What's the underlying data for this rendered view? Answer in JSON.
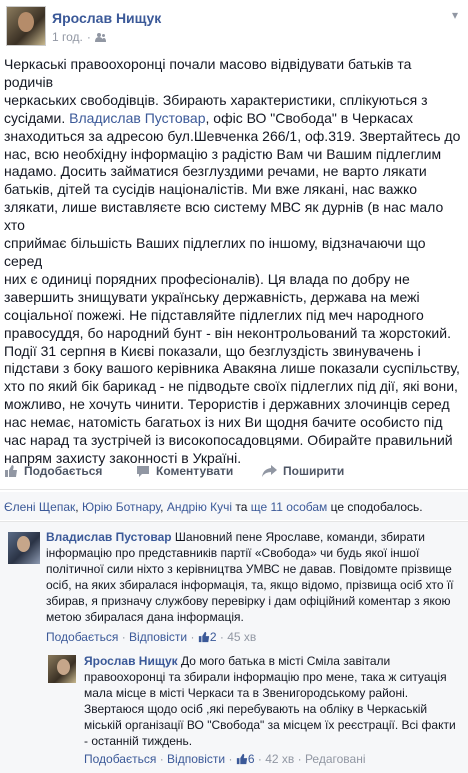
{
  "post": {
    "author": "Ярослав Нищук",
    "time": "1 год.",
    "time_sep": "·",
    "body_lines": [
      "Черкаські правоохоронці почали масово відвідувати батьків та родичів",
      "черкаських свободівців. Збирають характеристики, сплікуються з",
      "сусідами.",
      "знаходиться за адресою бул.Шевченка 266/1, оф.319. Звертайтесь до",
      "нас, всю необхідну інформацію з радістю Вам чи Вашим підлеглим",
      "надамо. Досить займатися безглуздими речами, не варто лякати",
      "батьків, дітей та сусідів націоналістів. Ми вже ляканi, нас важко",
      "злякати, лише виставляєте всю систему МВС як дурнів (в нас мало хто",
      "сприймає більшість Ваших підлеглих по іншому, відзначаючи що серед",
      "них є одиниці порядних професіоналів). Ця влада по добру не",
      "завершить знищувати українську державність, держава на межі",
      "соціальної пожежі. Не підставляйте підлеглих під меч народного",
      "правосуддя, бо народний бунт - він неконтрольований та жорстокий.",
      "Події 31 серпня в Києві показали, що безглуздість звинувачень і",
      "підстави з боку вашого керівника Авакяна лише показали суспільству,",
      "хто по який бік барикад - не підводьте своїх підлеглих під дії, які вони,",
      "можливо, не хочуть чинити. Терористів і державних злочинців серед",
      "нас немає, натомість багатьох із них Ви щодня бачите особисто під",
      "час нарад та зустрічей із високопосадовцями. Обирайте правильний",
      "напрям захисту законності в Україні."
    ],
    "mention_name": "Владислав Пустовар",
    "line3_rest": ", офіс ВО \"Свобода\" в Черкасах"
  },
  "actions": {
    "like": "Подобається",
    "comment": "Коментувати",
    "share": "Поширити"
  },
  "likes": {
    "names": [
      "Єлені Щепак",
      "Юрію Ботнару",
      "Андрію Кучі"
    ],
    "sep": ", ",
    "and_text": " та ",
    "others": "ще 11 особам",
    "tail": " це сподобалось."
  },
  "comments": [
    {
      "author": "Владислав Пустовар",
      "lines": [
        " Шановний пене Ярославе, команди, збирати",
        "інформацію про представників партії «Свобода» чи будь якої іншої",
        "політичної сили ніхто з керівництва УМВС не давав. Повідомте прізвище",
        "осіб, на яких збиралася інформація, та, якщо відомо, прізвища осіб хто її",
        "збирав, я призначу службову перевірку і дам офіційний коментар з якою",
        "метою збиралася дана інформація."
      ],
      "like": "Подобається",
      "reply": "Відповісти",
      "like_count": "2",
      "time": "45 хв",
      "dot": "·"
    },
    {
      "author": "Ярослав Нищук",
      "lines": [
        " До мого батька в місті Сміла завітали",
        "правоохоронці та збирали інформацію про мене, така ж ситуація",
        "мала місце в місті Черкаси та в Звенигородському районі.",
        "Звертаюся щодо осіб ,які перебувають на обліку в Черкаській",
        "міській організації ВО \"Свобода\" за місцем їх реєстрації. Всі факти",
        "- останній тиждень."
      ],
      "like": "Подобається",
      "reply": "Відповісти",
      "like_count": "6",
      "time": "42 хв",
      "edited": "Редаговані",
      "dot": "·"
    }
  ]
}
